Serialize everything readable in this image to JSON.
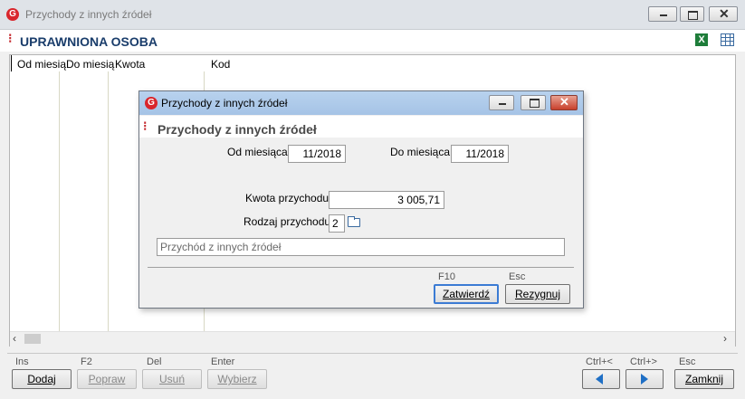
{
  "main_window": {
    "title": "Przychody z innych źródeł",
    "app_icon_letter": "G",
    "section_title": "UPRAWNIONA OSOBA",
    "columns": [
      "Od miesią",
      "Do miesią",
      "Kwota",
      "Kod"
    ]
  },
  "toolbar": {
    "buttons": [
      {
        "key": "Ins",
        "label": "Dodaj",
        "enabled": true
      },
      {
        "key": "F2",
        "label": "Popraw",
        "enabled": false
      },
      {
        "key": "Del",
        "label": "Usuń",
        "enabled": false
      },
      {
        "key": "Enter",
        "label": "Wybierz",
        "enabled": false
      }
    ],
    "nav_prev_key": "Ctrl+<",
    "nav_next_key": "Ctrl+>",
    "close_key": "Esc",
    "close_label": "Zamknij"
  },
  "dialog": {
    "title": "Przychody z innych źródeł",
    "app_icon_letter": "G",
    "header": "Przychody z innych źródeł",
    "od_miesiaca_label": "Od miesiąca",
    "od_miesiaca_value": "11/2018",
    "do_miesiaca_label": "Do miesiąca",
    "do_miesiaca_value": "11/2018",
    "kwota_label": "Kwota przychodu",
    "kwota_value": "3 005,71",
    "rodzaj_label": "Rodzaj przychodu",
    "rodzaj_value": "2",
    "description": "Przychód z innych źródeł",
    "confirm_key": "F10",
    "confirm_label": "Zatwierdź",
    "cancel_key": "Esc",
    "cancel_label": "Rezygnuj"
  },
  "colors": {
    "accent_red": "#c4272c",
    "selection_blue": "#3b7bd4",
    "nav_arrow_blue": "#1f6fc5",
    "excel_green": "#1e7d3a"
  }
}
